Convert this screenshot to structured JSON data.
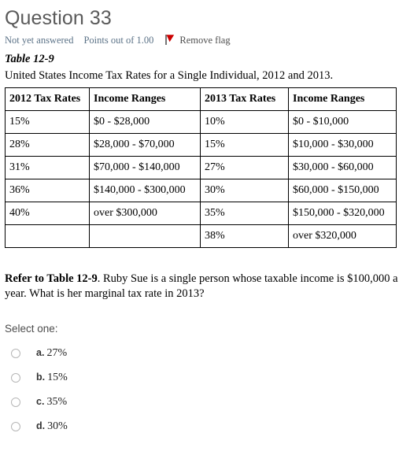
{
  "question": {
    "title": "Question 33",
    "state": "Not yet answered",
    "grade": "Points out of 1.00",
    "flag_label": "Remove flag",
    "flag_icon": "flag-icon",
    "flag_color": "#cc0000"
  },
  "table": {
    "caption": "Table 12-9",
    "description": "United States Income Tax Rates for a Single Individual, 2012 and 2013.",
    "headers": [
      "2012 Tax Rates",
      "Income Ranges",
      "2013 Tax Rates",
      "Income Ranges"
    ],
    "rows": [
      [
        "15%",
        "$0 - $28,000",
        "10%",
        "$0 - $10,000"
      ],
      [
        "28%",
        "$28,000 - $70,000",
        "15%",
        "$10,000 - $30,000"
      ],
      [
        "31%",
        "$70,000 - $140,000",
        "27%",
        "$30,000 - $60,000"
      ],
      [
        "36%",
        "$140,000 - $300,000",
        "30%",
        "$60,000 - $150,000"
      ],
      [
        "40%",
        "over $300,000",
        "35%",
        "$150,000 - $320,000"
      ],
      [
        "",
        "",
        "38%",
        "over $320,000"
      ]
    ]
  },
  "prompt": {
    "lead": "Refer to Table 12-9",
    "text": ". Ruby Sue is a single person whose taxable income is $100,000 a year. What is her marginal tax rate in 2013?"
  },
  "answers": {
    "instruction": "Select one:",
    "options": [
      {
        "letter": "a.",
        "value": "27%"
      },
      {
        "letter": "b.",
        "value": "15%"
      },
      {
        "letter": "c.",
        "value": "35%"
      },
      {
        "letter": "d.",
        "value": "30%"
      }
    ]
  }
}
